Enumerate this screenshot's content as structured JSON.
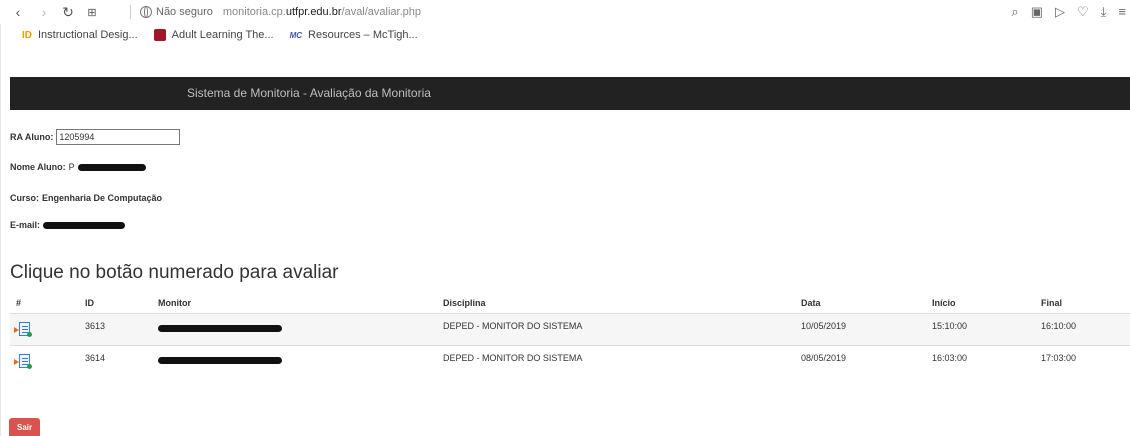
{
  "browser": {
    "insecure_label": "Não seguro",
    "url_host_prefix": "monitoria.cp.",
    "url_host_main": "utfpr.edu.br",
    "url_path": "/aval/avaliar.php"
  },
  "bookmarks": [
    {
      "icon": "id-icon",
      "label": "Instructional Desig..."
    },
    {
      "icon": "adult-learning-icon",
      "label": "Adult Learning The..."
    },
    {
      "icon": "mctighe-icon",
      "label": "Resources – McTigh..."
    }
  ],
  "app": {
    "title": "Sistema de Monitoria - Avaliação da Monitoria"
  },
  "student": {
    "ra_label": "RA Aluno:",
    "ra_value": "1205994",
    "name_label": "Nome Aluno:",
    "name_prefix": "P",
    "course_label": "Curso:",
    "course_value": "Engenharia De Computação",
    "email_label": "E-mail:"
  },
  "main": {
    "heading": "Clique no botão numerado para avaliar"
  },
  "table": {
    "columns": [
      "#",
      "ID",
      "Monitor",
      "Disciplina",
      "Data",
      "Início",
      "Final"
    ],
    "rows": [
      {
        "id": "3613",
        "disciplina": "DEPED - MONITOR DO SISTEMA",
        "data": "10/05/2019",
        "inicio": "15:10:00",
        "final": "16:10:00"
      },
      {
        "id": "3614",
        "disciplina": "DEPED - MONITOR DO SISTEMA",
        "data": "08/05/2019",
        "inicio": "16:03:00",
        "final": "17:03:00"
      }
    ]
  },
  "actions": {
    "sair_label": "Sair"
  }
}
